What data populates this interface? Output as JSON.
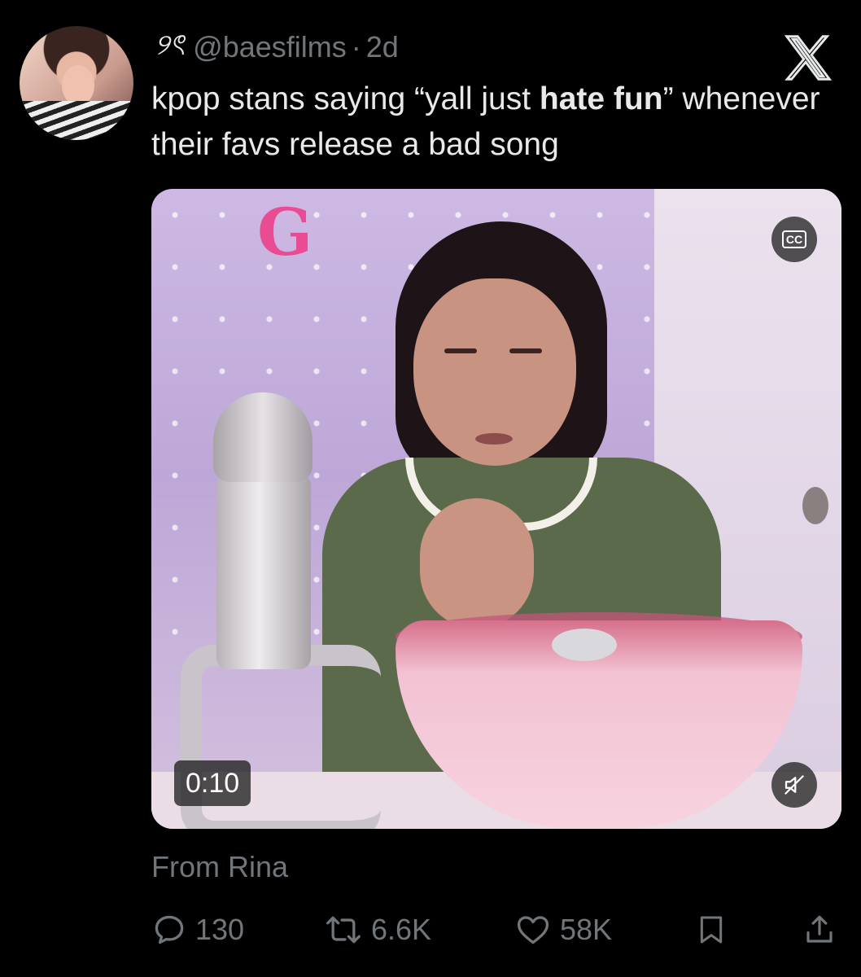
{
  "tweet": {
    "display_name": "୨ৎ",
    "handle": "@baesfilms",
    "separator": "·",
    "time": "2d",
    "text_before_bold": "kpop stans saying “yall just ",
    "text_bold": "hate fun",
    "text_after_bold": "” whenever their favs release a bad song"
  },
  "media": {
    "timestamp": "0:10",
    "cc_label": "CC"
  },
  "attribution": "From Rina",
  "actions": {
    "replies": "130",
    "reposts": "6.6K",
    "likes": "58K"
  },
  "icons": [
    "x-logo-icon",
    "cc-icon",
    "mute-icon",
    "reply-icon",
    "repost-icon",
    "like-icon",
    "bookmark-icon",
    "share-icon"
  ]
}
